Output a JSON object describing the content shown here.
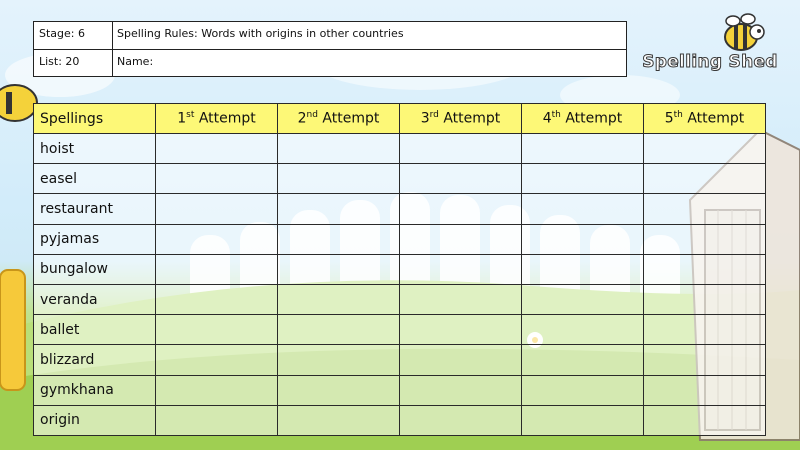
{
  "header": {
    "stage_label": "Stage: 6",
    "list_label": "List: 20",
    "rule_label": "Spelling Rules:  Words with origins in other countries",
    "name_label": "Name:"
  },
  "logo": {
    "text": "Spelling Shed",
    "icon": "bee-icon"
  },
  "table": {
    "col_spellings": "Spellings",
    "attempts": [
      {
        "num": "1",
        "sup": "st",
        "word": " Attempt"
      },
      {
        "num": "2",
        "sup": "nd",
        "word": " Attempt"
      },
      {
        "num": "3",
        "sup": "rd",
        "word": " Attempt"
      },
      {
        "num": "4",
        "sup": "th",
        "word": " Attempt"
      },
      {
        "num": "5",
        "sup": "th",
        "word": " Attempt"
      }
    ],
    "words": [
      "hoist",
      "easel",
      "restaurant",
      "pyjamas",
      "bungalow",
      "veranda",
      "ballet",
      "blizzard",
      "gymkhana",
      "origin"
    ]
  },
  "colors": {
    "header_fill": "#fdf877",
    "border": "#2a2a2a",
    "grass": "#a6d45c",
    "sky": "#d2ecfa"
  }
}
